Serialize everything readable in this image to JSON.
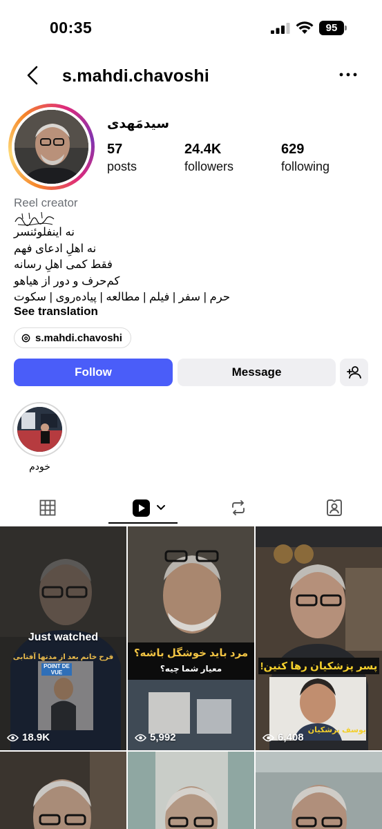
{
  "status_bar": {
    "time": "00:35",
    "battery": "95"
  },
  "header": {
    "username": "s.mahdi.chavoshi"
  },
  "profile": {
    "display_name": "سیدمَهدی",
    "stats": [
      {
        "count": "57",
        "label": "posts"
      },
      {
        "count": "24.4K",
        "label": "followers"
      },
      {
        "count": "629",
        "label": "following"
      }
    ],
    "category": "Reel creator",
    "bio_calligraphy": "بسم الله الرحمن الرحیم",
    "bio_lines": [
      "نه اینفلوئنسر",
      "نه اهلِ ادعای فهم",
      "فقط کمی اهلِ رسانه",
      "کم‌حرف و دور از هیاهو",
      "حرم | سفر | فیلم | مطالعه | پیاده‌روی | سکوت"
    ],
    "see_translation": "See translation",
    "threads_handle": "s.mahdi.chavoshi"
  },
  "actions": {
    "follow": "Follow",
    "message": "Message"
  },
  "highlights": [
    {
      "label": "خودم"
    }
  ],
  "tabs": [
    "grid-icon",
    "reels-icon",
    "reposts-icon",
    "tagged-icon"
  ],
  "reels": [
    {
      "views": "18.9K",
      "overlay": "Just watched",
      "caption_top": "فرح خانم بعد از مدتها آفتابی شده",
      "magazine": "POINT DE VUE"
    },
    {
      "views": "5,992",
      "caption_top": "مرد باید خوشگل باشه؟",
      "caption_sub": "معیار شما چیه؟"
    },
    {
      "views": "6,408",
      "caption_top": "پسر پزشکیان رها کنین!",
      "caption_sub": "یوسف پزشکیان"
    }
  ],
  "colors": {
    "accent": "#4a5df9",
    "secondary_button": "#efeff2",
    "muted_text": "#6b6f75"
  }
}
